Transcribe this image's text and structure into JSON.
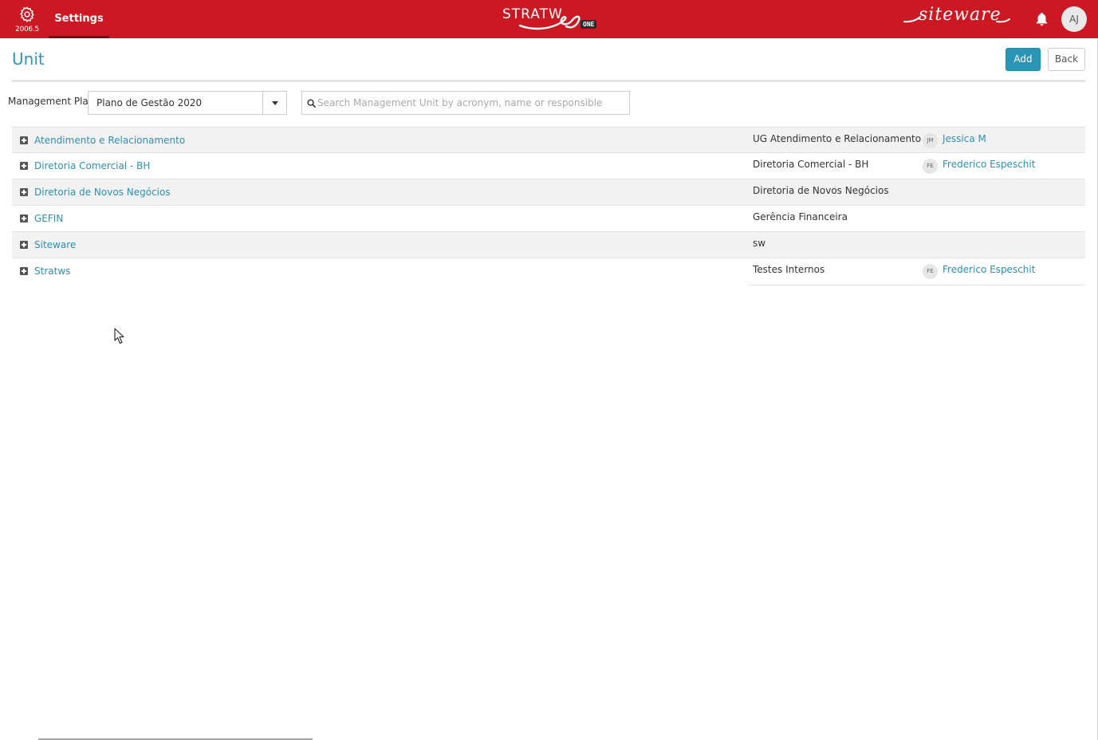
{
  "topbar": {
    "version": "2006.5",
    "settings_label": "Settings",
    "logo_text": "STRATW",
    "logo_badge": "ONE",
    "brand": "siteware",
    "user_initials": "AJ",
    "color": "#cc1822"
  },
  "page": {
    "title": "Unit",
    "add_label": "Add",
    "back_label": "Back"
  },
  "filters": {
    "plan_label": "Management Plan",
    "plan_value": "Plano de Gestão 2020",
    "search_placeholder": "Search Management Unit by acronym, name or responsible",
    "search_value": ""
  },
  "units": [
    {
      "name": "Atendimento e Relacionamento",
      "description": "UG Atendimento e Relacionamento",
      "responsible_initials": "JM",
      "responsible": "Jessica M"
    },
    {
      "name": "Diretoria Comercial - BH",
      "description": "Diretoria Comercial - BH",
      "responsible_initials": "FE",
      "responsible": "Frederico Espeschit"
    },
    {
      "name": "Diretoria de Novos Negócios",
      "description": "Diretoria de Novos Negócios",
      "responsible_initials": "",
      "responsible": ""
    },
    {
      "name": "GEFIN",
      "description": "Gerência Financeira",
      "responsible_initials": "",
      "responsible": ""
    },
    {
      "name": "Siteware",
      "description": "sw",
      "responsible_initials": "",
      "responsible": ""
    },
    {
      "name": "Stratws",
      "description": "Testes Internos",
      "responsible_initials": "FE",
      "responsible": "Frederico Espeschit"
    }
  ]
}
